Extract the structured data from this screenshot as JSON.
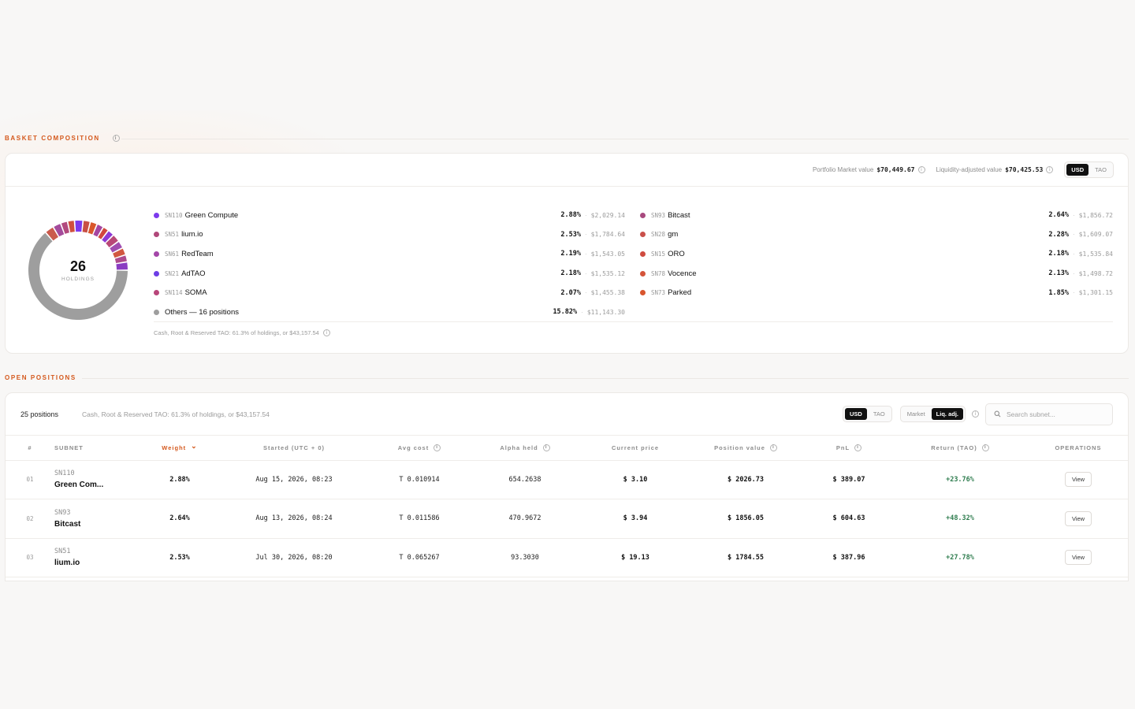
{
  "basket": {
    "section_title": "BASKET COMPOSITION",
    "portfolio_market_label": "Portfolio Market value",
    "portfolio_market_value": "$70,449.67",
    "liquidity_label": "Liquidity-adjusted value",
    "liquidity_value": "$70,425.53",
    "currency_toggle": {
      "usd": "USD",
      "tao": "TAO",
      "selected": "USD"
    },
    "donut": {
      "count": "26",
      "label": "HOLDINGS",
      "segments": [
        {
          "value": 61.3,
          "color": "#9e9e9e"
        },
        {
          "value": 2.88,
          "color": "#ca5a4c"
        },
        {
          "value": 2.53,
          "color": "#a44b9b"
        },
        {
          "value": 2.19,
          "color": "#b24a7e"
        },
        {
          "value": 2.18,
          "color": "#d04f3f"
        },
        {
          "value": 2.64,
          "color": "#7c3aed"
        },
        {
          "value": 2.28,
          "color": "#c84f45"
        },
        {
          "value": 2.18,
          "color": "#d9572b"
        },
        {
          "value": 2.13,
          "color": "#a546a0"
        },
        {
          "value": 1.85,
          "color": "#d1473d"
        },
        {
          "value": 2.07,
          "color": "#8d3ad4"
        },
        {
          "value": 2.5,
          "color": "#b84877"
        },
        {
          "value": 2.4,
          "color": "#a04db0"
        },
        {
          "value": 2.3,
          "color": "#d15740"
        },
        {
          "value": 2.2,
          "color": "#ad4b8e"
        },
        {
          "value": 2.6,
          "color": "#8a3cc2"
        }
      ]
    },
    "holdings_left": [
      {
        "sn": "SN110",
        "name": "Green Compute",
        "pct": "2.88%",
        "usd": "$2,029.14",
        "color": "#7c3aed"
      },
      {
        "sn": "SN51",
        "name": "lium.io",
        "pct": "2.53%",
        "usd": "$1,784.64",
        "color": "#b0487a"
      },
      {
        "sn": "SN61",
        "name": "RedTeam",
        "pct": "2.19%",
        "usd": "$1,543.05",
        "color": "#a446a8"
      },
      {
        "sn": "SN21",
        "name": "AdTAO",
        "pct": "2.18%",
        "usd": "$1,535.12",
        "color": "#6d3ee6"
      },
      {
        "sn": "SN114",
        "name": "SOMA",
        "pct": "2.07%",
        "usd": "$1,455.38",
        "color": "#b8467a"
      },
      {
        "sn": "",
        "name": "Others — 16 positions",
        "pct": "15.82%",
        "usd": "$11,143.30",
        "color": "#9e9e9e"
      }
    ],
    "holdings_right": [
      {
        "sn": "SN93",
        "name": "Bitcast",
        "pct": "2.64%",
        "usd": "$1,856.72",
        "color": "#a8497e"
      },
      {
        "sn": "SN28",
        "name": "gm",
        "pct": "2.28%",
        "usd": "$1,609.07",
        "color": "#c9504a"
      },
      {
        "sn": "SN15",
        "name": "ORO",
        "pct": "2.18%",
        "usd": "$1,535.84",
        "color": "#cf4b3f"
      },
      {
        "sn": "SN78",
        "name": "Vocence",
        "pct": "2.13%",
        "usd": "$1,498.72",
        "color": "#d4543a"
      },
      {
        "sn": "SN73",
        "name": "Parked",
        "pct": "1.85%",
        "usd": "$1,301.15",
        "color": "#d8552e"
      }
    ],
    "separator": "·",
    "cash_note": "Cash, Root & Reserved TAO: 61.3% of holdings, or $43,157.54"
  },
  "positions": {
    "section_title": "OPEN POSITIONS",
    "count_label": "25 positions",
    "cash_note": "Cash, Root & Reserved TAO: 61.3% of holdings, or $43,157.54",
    "currency_toggle": {
      "usd": "USD",
      "tao": "TAO",
      "selected": "USD"
    },
    "value_toggle": {
      "market": "Market",
      "liq": "Liq. adj.",
      "selected": "Liq. adj."
    },
    "search_placeholder": "Search subnet...",
    "columns": {
      "idx": "#",
      "subnet": "SUBNET",
      "weight": "Weight",
      "started": "Started (UTC + 0)",
      "avg_cost": "Avg cost",
      "alpha": "Alpha held",
      "price": "Current price",
      "value": "Position value",
      "pnl": "PnL",
      "ret": "Return (TAO)",
      "ops": "OPERATIONS"
    },
    "rows": [
      {
        "idx": "01",
        "sn": "SN110",
        "name": "Green Com...",
        "weight": "2.88%",
        "started": "Aug 15, 2026, 08:23",
        "avg_cost": "T 0.010914",
        "alpha": "654.2638",
        "price": "$ 3.10",
        "value": "$ 2026.73",
        "pnl": "$ 389.07",
        "ret": "+23.76%",
        "op": "View"
      },
      {
        "idx": "02",
        "sn": "SN93",
        "name": "Bitcast",
        "weight": "2.64%",
        "started": "Aug 13, 2026, 08:24",
        "avg_cost": "T 0.011586",
        "alpha": "470.9672",
        "price": "$ 3.94",
        "value": "$ 1856.05",
        "pnl": "$ 604.63",
        "ret": "+48.32%",
        "op": "View"
      },
      {
        "idx": "03",
        "sn": "SN51",
        "name": "lium.io",
        "weight": "2.53%",
        "started": "Jul 30, 2026, 08:20",
        "avg_cost": "T 0.065267",
        "alpha": "93.3030",
        "price": "$ 19.13",
        "value": "$ 1784.55",
        "pnl": "$ 387.96",
        "ret": "+27.78%",
        "op": "View"
      }
    ]
  },
  "icons": {
    "info": "i",
    "sort_desc": "⌄",
    "search": "search-icon"
  }
}
